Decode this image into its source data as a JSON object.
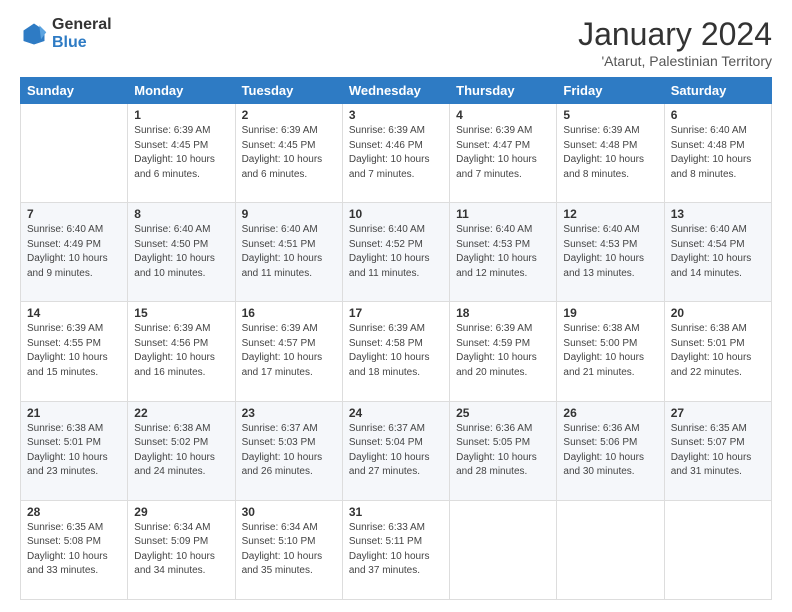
{
  "logo": {
    "general": "General",
    "blue": "Blue"
  },
  "title": "January 2024",
  "subtitle": "'Atarut, Palestinian Territory",
  "days_of_week": [
    "Sunday",
    "Monday",
    "Tuesday",
    "Wednesday",
    "Thursday",
    "Friday",
    "Saturday"
  ],
  "weeks": [
    [
      {
        "day": "",
        "sunrise": "",
        "sunset": "",
        "daylight": ""
      },
      {
        "day": "1",
        "sunrise": "Sunrise: 6:39 AM",
        "sunset": "Sunset: 4:45 PM",
        "daylight": "Daylight: 10 hours and 6 minutes."
      },
      {
        "day": "2",
        "sunrise": "Sunrise: 6:39 AM",
        "sunset": "Sunset: 4:45 PM",
        "daylight": "Daylight: 10 hours and 6 minutes."
      },
      {
        "day": "3",
        "sunrise": "Sunrise: 6:39 AM",
        "sunset": "Sunset: 4:46 PM",
        "daylight": "Daylight: 10 hours and 7 minutes."
      },
      {
        "day": "4",
        "sunrise": "Sunrise: 6:39 AM",
        "sunset": "Sunset: 4:47 PM",
        "daylight": "Daylight: 10 hours and 7 minutes."
      },
      {
        "day": "5",
        "sunrise": "Sunrise: 6:39 AM",
        "sunset": "Sunset: 4:48 PM",
        "daylight": "Daylight: 10 hours and 8 minutes."
      },
      {
        "day": "6",
        "sunrise": "Sunrise: 6:40 AM",
        "sunset": "Sunset: 4:48 PM",
        "daylight": "Daylight: 10 hours and 8 minutes."
      }
    ],
    [
      {
        "day": "7",
        "sunrise": "Sunrise: 6:40 AM",
        "sunset": "Sunset: 4:49 PM",
        "daylight": "Daylight: 10 hours and 9 minutes."
      },
      {
        "day": "8",
        "sunrise": "Sunrise: 6:40 AM",
        "sunset": "Sunset: 4:50 PM",
        "daylight": "Daylight: 10 hours and 10 minutes."
      },
      {
        "day": "9",
        "sunrise": "Sunrise: 6:40 AM",
        "sunset": "Sunset: 4:51 PM",
        "daylight": "Daylight: 10 hours and 11 minutes."
      },
      {
        "day": "10",
        "sunrise": "Sunrise: 6:40 AM",
        "sunset": "Sunset: 4:52 PM",
        "daylight": "Daylight: 10 hours and 11 minutes."
      },
      {
        "day": "11",
        "sunrise": "Sunrise: 6:40 AM",
        "sunset": "Sunset: 4:53 PM",
        "daylight": "Daylight: 10 hours and 12 minutes."
      },
      {
        "day": "12",
        "sunrise": "Sunrise: 6:40 AM",
        "sunset": "Sunset: 4:53 PM",
        "daylight": "Daylight: 10 hours and 13 minutes."
      },
      {
        "day": "13",
        "sunrise": "Sunrise: 6:40 AM",
        "sunset": "Sunset: 4:54 PM",
        "daylight": "Daylight: 10 hours and 14 minutes."
      }
    ],
    [
      {
        "day": "14",
        "sunrise": "Sunrise: 6:39 AM",
        "sunset": "Sunset: 4:55 PM",
        "daylight": "Daylight: 10 hours and 15 minutes."
      },
      {
        "day": "15",
        "sunrise": "Sunrise: 6:39 AM",
        "sunset": "Sunset: 4:56 PM",
        "daylight": "Daylight: 10 hours and 16 minutes."
      },
      {
        "day": "16",
        "sunrise": "Sunrise: 6:39 AM",
        "sunset": "Sunset: 4:57 PM",
        "daylight": "Daylight: 10 hours and 17 minutes."
      },
      {
        "day": "17",
        "sunrise": "Sunrise: 6:39 AM",
        "sunset": "Sunset: 4:58 PM",
        "daylight": "Daylight: 10 hours and 18 minutes."
      },
      {
        "day": "18",
        "sunrise": "Sunrise: 6:39 AM",
        "sunset": "Sunset: 4:59 PM",
        "daylight": "Daylight: 10 hours and 20 minutes."
      },
      {
        "day": "19",
        "sunrise": "Sunrise: 6:38 AM",
        "sunset": "Sunset: 5:00 PM",
        "daylight": "Daylight: 10 hours and 21 minutes."
      },
      {
        "day": "20",
        "sunrise": "Sunrise: 6:38 AM",
        "sunset": "Sunset: 5:01 PM",
        "daylight": "Daylight: 10 hours and 22 minutes."
      }
    ],
    [
      {
        "day": "21",
        "sunrise": "Sunrise: 6:38 AM",
        "sunset": "Sunset: 5:01 PM",
        "daylight": "Daylight: 10 hours and 23 minutes."
      },
      {
        "day": "22",
        "sunrise": "Sunrise: 6:38 AM",
        "sunset": "Sunset: 5:02 PM",
        "daylight": "Daylight: 10 hours and 24 minutes."
      },
      {
        "day": "23",
        "sunrise": "Sunrise: 6:37 AM",
        "sunset": "Sunset: 5:03 PM",
        "daylight": "Daylight: 10 hours and 26 minutes."
      },
      {
        "day": "24",
        "sunrise": "Sunrise: 6:37 AM",
        "sunset": "Sunset: 5:04 PM",
        "daylight": "Daylight: 10 hours and 27 minutes."
      },
      {
        "day": "25",
        "sunrise": "Sunrise: 6:36 AM",
        "sunset": "Sunset: 5:05 PM",
        "daylight": "Daylight: 10 hours and 28 minutes."
      },
      {
        "day": "26",
        "sunrise": "Sunrise: 6:36 AM",
        "sunset": "Sunset: 5:06 PM",
        "daylight": "Daylight: 10 hours and 30 minutes."
      },
      {
        "day": "27",
        "sunrise": "Sunrise: 6:35 AM",
        "sunset": "Sunset: 5:07 PM",
        "daylight": "Daylight: 10 hours and 31 minutes."
      }
    ],
    [
      {
        "day": "28",
        "sunrise": "Sunrise: 6:35 AM",
        "sunset": "Sunset: 5:08 PM",
        "daylight": "Daylight: 10 hours and 33 minutes."
      },
      {
        "day": "29",
        "sunrise": "Sunrise: 6:34 AM",
        "sunset": "Sunset: 5:09 PM",
        "daylight": "Daylight: 10 hours and 34 minutes."
      },
      {
        "day": "30",
        "sunrise": "Sunrise: 6:34 AM",
        "sunset": "Sunset: 5:10 PM",
        "daylight": "Daylight: 10 hours and 35 minutes."
      },
      {
        "day": "31",
        "sunrise": "Sunrise: 6:33 AM",
        "sunset": "Sunset: 5:11 PM",
        "daylight": "Daylight: 10 hours and 37 minutes."
      },
      {
        "day": "",
        "sunrise": "",
        "sunset": "",
        "daylight": ""
      },
      {
        "day": "",
        "sunrise": "",
        "sunset": "",
        "daylight": ""
      },
      {
        "day": "",
        "sunrise": "",
        "sunset": "",
        "daylight": ""
      }
    ]
  ]
}
